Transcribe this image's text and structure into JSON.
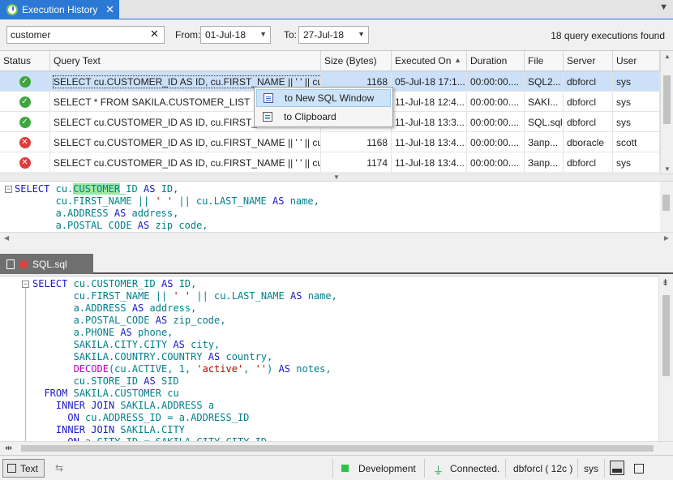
{
  "tab": {
    "title": "Execution History"
  },
  "filter": {
    "search_value": "customer",
    "from_label": "From:",
    "from_value": "01-Jul-18",
    "to_label": "To:",
    "to_value": "27-Jul-18",
    "found_text": "18 query executions found"
  },
  "grid": {
    "columns": [
      "Status",
      "Query Text",
      "Size (Bytes)",
      "Executed On",
      "Duration",
      "File",
      "Server",
      "User"
    ],
    "rows": [
      {
        "status": "ok",
        "query": "SELECT cu.CUSTOMER_ID AS ID, cu.FIRST_NAME || ' ' || cu.LAS...",
        "size": "1168",
        "executed": "05-Jul-18 17:1...",
        "duration": "00:00:00....",
        "file": "SQL2...",
        "server": "dbforcl",
        "user": "sys"
      },
      {
        "status": "ok",
        "query": "SELECT * FROM SAKILA.CUSTOMER_LIST",
        "size": "",
        "executed": "11-Jul-18 12:4...",
        "duration": "00:00:00....",
        "file": "SAKI...",
        "server": "dbforcl",
        "user": "sys"
      },
      {
        "status": "ok",
        "query": "SELECT cu.CUSTOMER_ID AS ID, cu.FIRST_NAME",
        "size": "",
        "executed": "11-Jul-18 13:3...",
        "duration": "00:00:00....",
        "file": "SQL.sql",
        "server": "dbforcl",
        "user": "sys"
      },
      {
        "status": "error",
        "query": "SELECT cu.CUSTOMER_ID AS ID, cu.FIRST_NAME || ' ' || cu.LAS...",
        "size": "1168",
        "executed": "11-Jul-18 13:4...",
        "duration": "00:00:00....",
        "file": "Запр...",
        "server": "dboracle",
        "user": "scott"
      },
      {
        "status": "error",
        "query": "SELECT cu.CUSTOMER_ID AS ID, cu.FIRST_NAME || ' ' || cu.LAS...",
        "size": "1174",
        "executed": "11-Jul-18 13:4...",
        "duration": "00:00:00....",
        "file": "Запр...",
        "server": "dbforcl",
        "user": "sys"
      }
    ]
  },
  "context_menu": {
    "items": [
      "to New SQL Window",
      "to Clipboard"
    ]
  },
  "preview": {
    "lines": [
      "SELECT cu.CUSTOMER_ID AS ID,",
      "       cu.FIRST_NAME || ' ' || cu.LAST_NAME AS name,",
      "       a.ADDRESS AS address,",
      "       a.POSTAL CODE AS zip code,"
    ],
    "highlight": "CUSTOMER"
  },
  "sql_tab": {
    "title": "SQL.sql"
  },
  "editor": {
    "lines": [
      "SELECT cu.CUSTOMER_ID AS ID,",
      "       cu.FIRST_NAME || ' ' || cu.LAST_NAME AS name,",
      "       a.ADDRESS AS address,",
      "       a.POSTAL_CODE AS zip_code,",
      "       a.PHONE AS phone,",
      "       SAKILA.CITY.CITY AS city,",
      "       SAKILA.COUNTRY.COUNTRY AS country,",
      "       DECODE(cu.ACTIVE, 1, 'active', '') AS notes,",
      "       cu.STORE_ID AS SID",
      "  FROM SAKILA.CUSTOMER cu",
      "    INNER JOIN SAKILA.ADDRESS a",
      "      ON cu.ADDRESS_ID = a.ADDRESS_ID",
      "    INNER JOIN SAKILA.CITY",
      "      ON a.CITY_ID = SAKILA.CITY.CITY_ID"
    ]
  },
  "status_bar": {
    "text_button": "Text",
    "environment": "Development",
    "connection": "Connected.",
    "server": "dbforcl ( 12c )",
    "user": "sys"
  },
  "colors": {
    "accent": "#2b79d4",
    "selection": "#cce0f7",
    "keyword": "#1a1ac8",
    "identifier": "#00808a",
    "string": "#c00000",
    "function": "#c000c0",
    "ok": "#3fa63f",
    "error": "#e03a3a"
  }
}
